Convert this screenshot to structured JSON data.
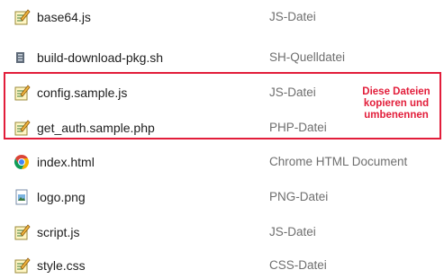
{
  "files": [
    {
      "name": "base64.js",
      "type": "JS-Datei",
      "icon": "script-file-icon"
    },
    {
      "name": "build-download-pkg.sh",
      "type": "SH-Quelldatei",
      "icon": "generic-file-icon"
    },
    {
      "name": "config.sample.js",
      "type": "JS-Datei",
      "icon": "script-file-icon"
    },
    {
      "name": "get_auth.sample.php",
      "type": "PHP-Datei",
      "icon": "script-file-icon"
    },
    {
      "name": "index.html",
      "type": "Chrome HTML Document",
      "icon": "chrome-icon"
    },
    {
      "name": "logo.png",
      "type": "PNG-Datei",
      "icon": "image-file-icon"
    },
    {
      "name": "script.js",
      "type": "JS-Datei",
      "icon": "script-file-icon"
    },
    {
      "name": "style.css",
      "type": "CSS-Datei",
      "icon": "script-file-icon"
    }
  ],
  "annotation": {
    "lines": [
      "Diese Dateien",
      "kopieren und",
      "umbenennen"
    ],
    "color": "#e21d3a"
  }
}
